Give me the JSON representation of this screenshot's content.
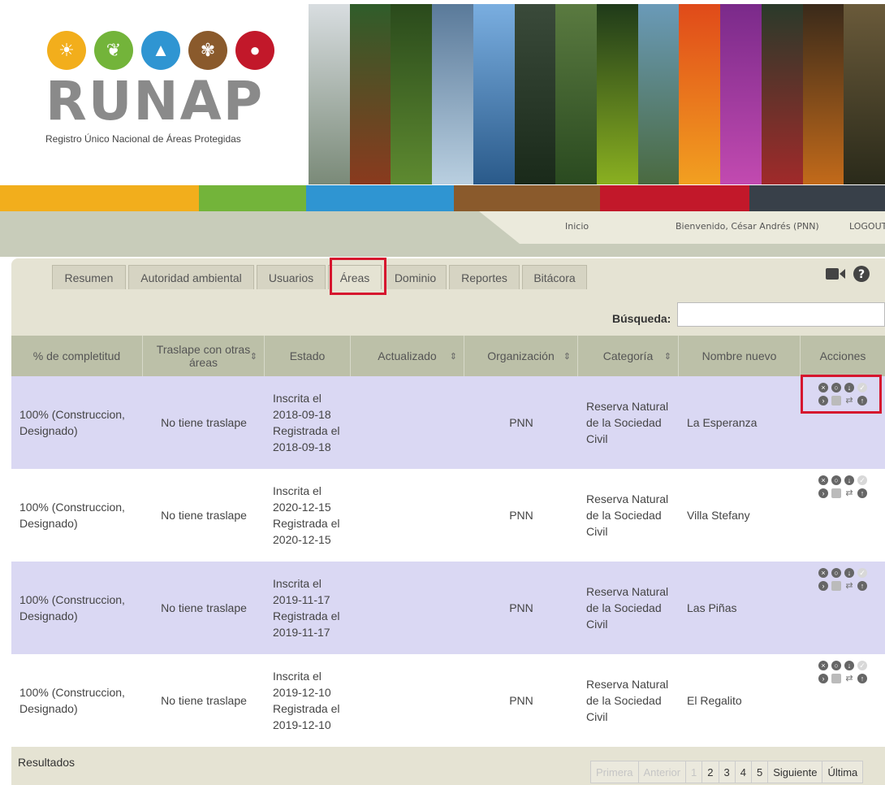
{
  "brand": {
    "name": "RUNAP",
    "subtitle": "Registro Único Nacional de Áreas Protegidas",
    "icons": [
      "sun-palm-icon",
      "leaf-icon",
      "mountain-icon",
      "grass-icon",
      "bear-icon"
    ]
  },
  "colors": {
    "bar": [
      "#f2ae1c",
      "#73b43a",
      "#2f95d2",
      "#8a5a2c",
      "#c2182a",
      "#384049"
    ],
    "highlight": "#d6162e"
  },
  "topnav": {
    "inicio": "Inicio",
    "welcome": "Bienvenido, César Andrés (PNN)",
    "logout": "LOGOUT"
  },
  "tabs": [
    {
      "label": "Resumen"
    },
    {
      "label": "Autoridad ambiental"
    },
    {
      "label": "Usuarios"
    },
    {
      "label": "Áreas"
    },
    {
      "label": "Dominio"
    },
    {
      "label": "Reportes"
    },
    {
      "label": "Bitácora"
    }
  ],
  "tab_icons": [
    "video-camera-icon",
    "help-icon"
  ],
  "search": {
    "label": "Búsqueda:",
    "value": ""
  },
  "table": {
    "headers": [
      "% de completitud",
      "Traslape con otras áreas",
      "Estado",
      "Actualizado",
      "Organización",
      "Categoría",
      "Nombre nuevo",
      "Acciones"
    ],
    "rows": [
      {
        "completitud": "100% (Construccion, Designado)",
        "traslape": "No tiene traslape",
        "estado": "Inscrita el 2018-09-18 Registrada el 2018-09-18",
        "actualizado": "",
        "organizacion": "PNN",
        "categoria": "Reserva Natural de la Sociedad Civil",
        "nombre": "La Esperanza"
      },
      {
        "completitud": "100% (Construccion, Designado)",
        "traslape": "No tiene traslape",
        "estado": "Inscrita el 2020-12-15 Registrada el 2020-12-15",
        "actualizado": "",
        "organizacion": "PNN",
        "categoria": "Reserva Natural de la Sociedad Civil",
        "nombre": "Villa Stefany"
      },
      {
        "completitud": "100% (Construccion, Designado)",
        "traslape": "No tiene traslape",
        "estado": "Inscrita el 2019-11-17 Registrada el 2019-11-17",
        "actualizado": "",
        "organizacion": "PNN",
        "categoria": "Reserva Natural de la Sociedad Civil",
        "nombre": "Las Piñas"
      },
      {
        "completitud": "100% (Construccion, Designado)",
        "traslape": "No tiene traslape",
        "estado": "Inscrita el 2019-12-10 Registrada el 2019-12-10",
        "actualizado": "",
        "organizacion": "PNN",
        "categoria": "Reserva Natural de la Sociedad Civil",
        "nombre": "El Regalito"
      }
    ]
  },
  "footer": {
    "results": "Resultados",
    "pager": [
      "Primera",
      "Anterior",
      "1",
      "2",
      "3",
      "4",
      "5",
      "Siguiente",
      "Última"
    ]
  }
}
